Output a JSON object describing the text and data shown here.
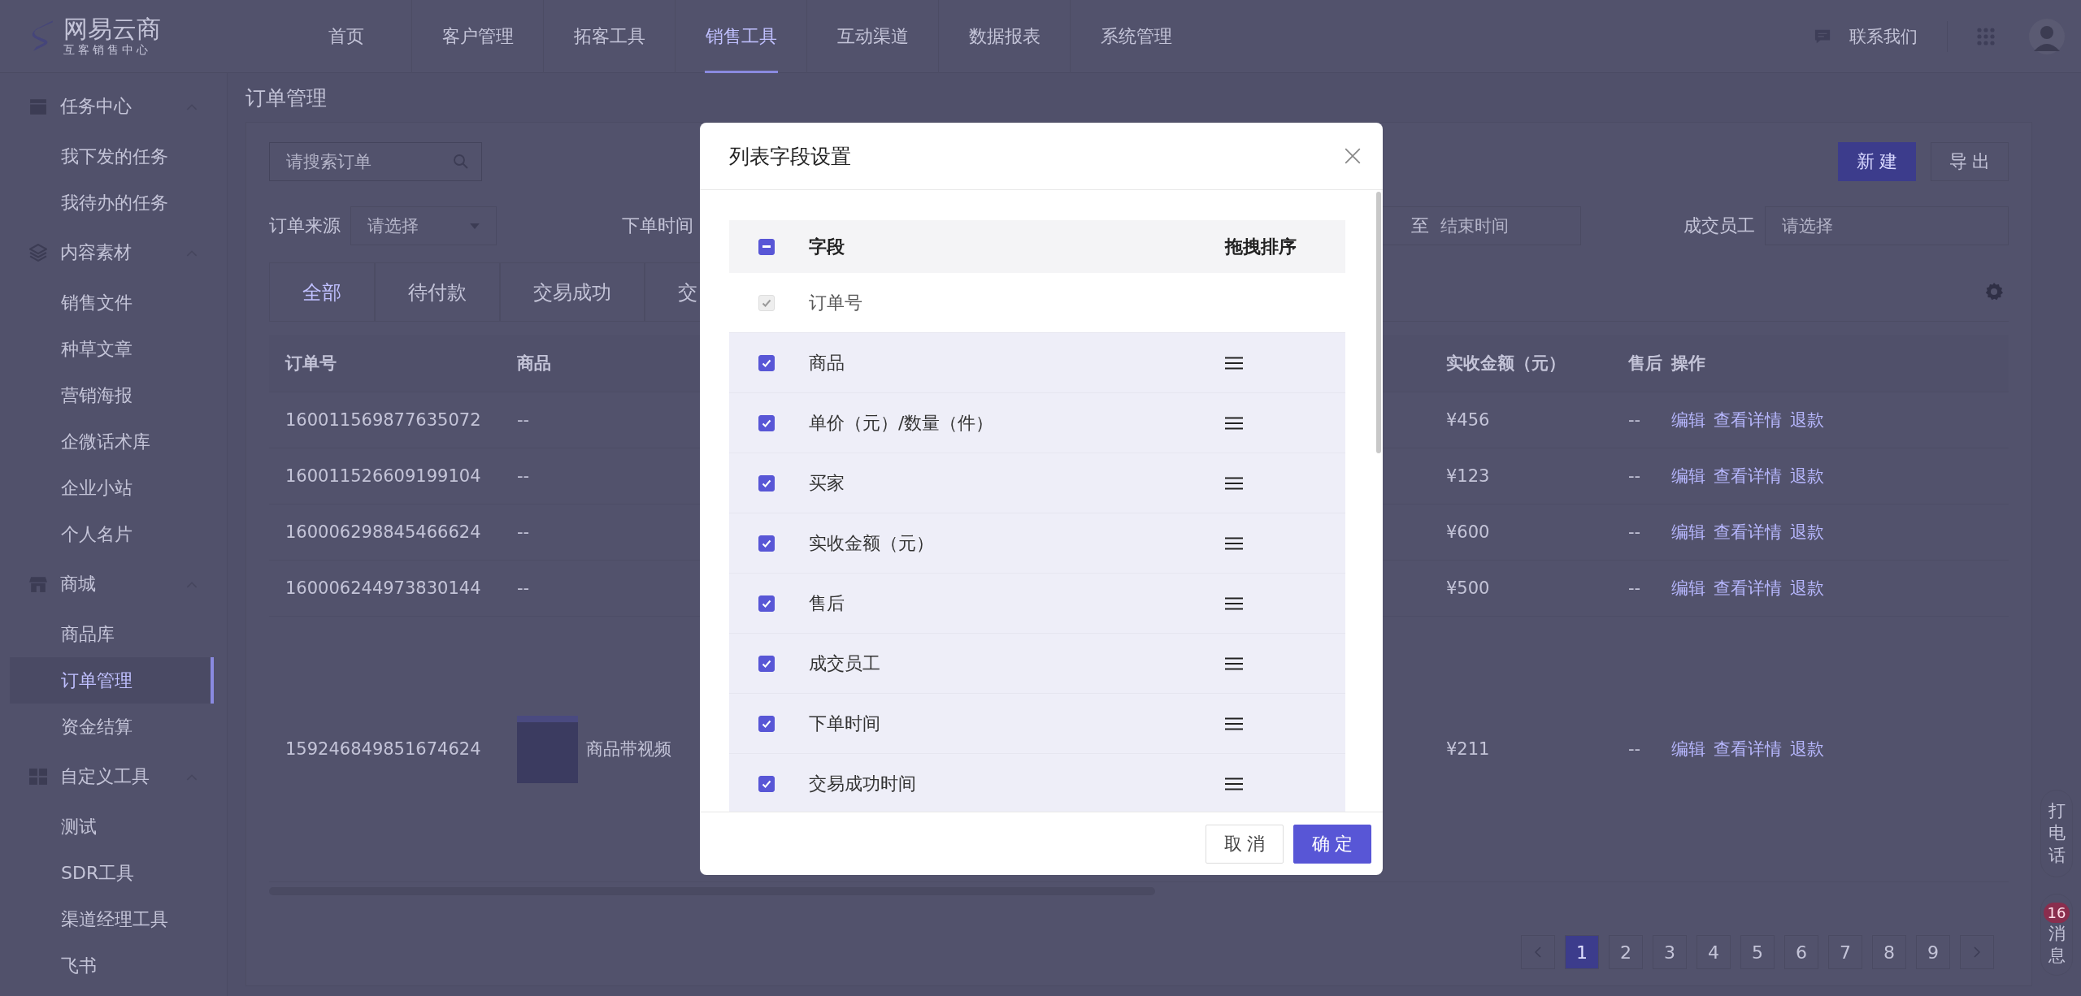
{
  "header": {
    "logo": {
      "name": "网易云商",
      "subtitle": "互客销售中心"
    },
    "nav": [
      {
        "label": "首页",
        "selected": false
      },
      {
        "label": "客户管理",
        "selected": false
      },
      {
        "label": "拓客工具",
        "selected": false
      },
      {
        "label": "销售工具",
        "selected": true
      },
      {
        "label": "互动渠道",
        "selected": false
      },
      {
        "label": "数据报表",
        "selected": false
      },
      {
        "label": "系统管理",
        "selected": false
      }
    ],
    "contact": "联系我们"
  },
  "sidebar": {
    "groups": [
      {
        "label": "任务中心",
        "expanded": true,
        "items": [
          {
            "label": "我下发的任务",
            "selected": false
          },
          {
            "label": "我待办的任务",
            "selected": false
          }
        ]
      },
      {
        "label": "内容素材",
        "expanded": true,
        "items": [
          {
            "label": "销售文件",
            "selected": false
          },
          {
            "label": "种草文章",
            "selected": false
          },
          {
            "label": "营销海报",
            "selected": false
          },
          {
            "label": "企微话术库",
            "selected": false
          },
          {
            "label": "企业小站",
            "selected": false
          },
          {
            "label": "个人名片",
            "selected": false
          }
        ]
      },
      {
        "label": "商城",
        "expanded": true,
        "items": [
          {
            "label": "商品库",
            "selected": false
          },
          {
            "label": "订单管理",
            "selected": true
          },
          {
            "label": "资金结算",
            "selected": false
          }
        ]
      },
      {
        "label": "自定义工具",
        "expanded": true,
        "items": [
          {
            "label": "测试",
            "selected": false
          },
          {
            "label": "SDR工具",
            "selected": false
          },
          {
            "label": "渠道经理工具",
            "selected": false
          },
          {
            "label": "飞书",
            "selected": false
          }
        ]
      }
    ]
  },
  "page": {
    "title": "订单管理",
    "search": {
      "placeholder": "请搜索订单"
    },
    "buttons": {
      "create": "新 建",
      "export": "导 出"
    },
    "filters": {
      "source": {
        "label": "订单来源",
        "placeholder": "请选择"
      },
      "time": {
        "label": "下单时间",
        "separator": "至",
        "end_placeholder": "结束时间"
      },
      "staff": {
        "label": "成交员工",
        "placeholder": "请选择"
      }
    },
    "tabs": [
      {
        "label": "全部",
        "selected": true
      },
      {
        "label": "待付款",
        "selected": false
      },
      {
        "label": "交易成功",
        "selected": false
      },
      {
        "label": "交",
        "selected": false
      }
    ],
    "table": {
      "columns": [
        "订单号",
        "商品",
        "实收金额（元）",
        "售后",
        "操作"
      ],
      "rows": [
        {
          "order_no": "160011569877635072",
          "product": "--",
          "amount": "¥456",
          "after_sale": "--",
          "actions": [
            "编辑",
            "查看详情",
            "退款"
          ]
        },
        {
          "order_no": "160011526609199104",
          "product": "--",
          "amount": "¥123",
          "after_sale": "--",
          "actions": [
            "编辑",
            "查看详情",
            "退款"
          ]
        },
        {
          "order_no": "160006298845466624",
          "product": "--",
          "amount": "¥600",
          "after_sale": "--",
          "actions": [
            "编辑",
            "查看详情",
            "退款"
          ]
        },
        {
          "order_no": "160006244973830144",
          "product": "--",
          "amount": "¥500",
          "after_sale": "--",
          "actions": [
            "编辑",
            "查看详情",
            "退款"
          ]
        },
        {
          "order_no": "159246849851674624",
          "product": "商品带视频",
          "kind": "media",
          "amount": "¥211",
          "after_sale": "--",
          "actions": [
            "编辑",
            "查看详情",
            "退款"
          ]
        }
      ]
    },
    "pagination": [
      {
        "label": "1",
        "selected": true
      },
      {
        "label": "2",
        "selected": false
      },
      {
        "label": "3",
        "selected": false
      },
      {
        "label": "4",
        "selected": false
      },
      {
        "label": "5",
        "selected": false
      },
      {
        "label": "6",
        "selected": false
      },
      {
        "label": "7",
        "selected": false
      },
      {
        "label": "8",
        "selected": false
      },
      {
        "label": "9",
        "selected": false
      }
    ]
  },
  "float_bar": {
    "call": "打电话",
    "messages": "消息",
    "message_count": "16"
  },
  "dialog": {
    "title": "列表字段设置",
    "header": {
      "indeterminate": true,
      "field": "字段",
      "sort": "拖拽排序"
    },
    "fields": [
      {
        "label": "订单号",
        "checked": true,
        "disabled": true,
        "kind": "fixed"
      },
      {
        "label": "商品",
        "checked": true,
        "disabled": false,
        "kind": "draggable"
      },
      {
        "label": "单价（元）/数量（件）",
        "checked": true,
        "disabled": false,
        "kind": "draggable"
      },
      {
        "label": "买家",
        "checked": true,
        "disabled": false,
        "kind": "draggable"
      },
      {
        "label": "实收金额（元）",
        "checked": true,
        "disabled": false,
        "kind": "draggable"
      },
      {
        "label": "售后",
        "checked": true,
        "disabled": false,
        "kind": "draggable"
      },
      {
        "label": "成交员工",
        "checked": true,
        "disabled": false,
        "kind": "draggable"
      },
      {
        "label": "下单时间",
        "checked": true,
        "disabled": false,
        "kind": "draggable"
      },
      {
        "label": "交易成功时间",
        "checked": true,
        "disabled": false,
        "kind": "draggable"
      }
    ],
    "cancel": "取 消",
    "confirm": "确 定"
  }
}
